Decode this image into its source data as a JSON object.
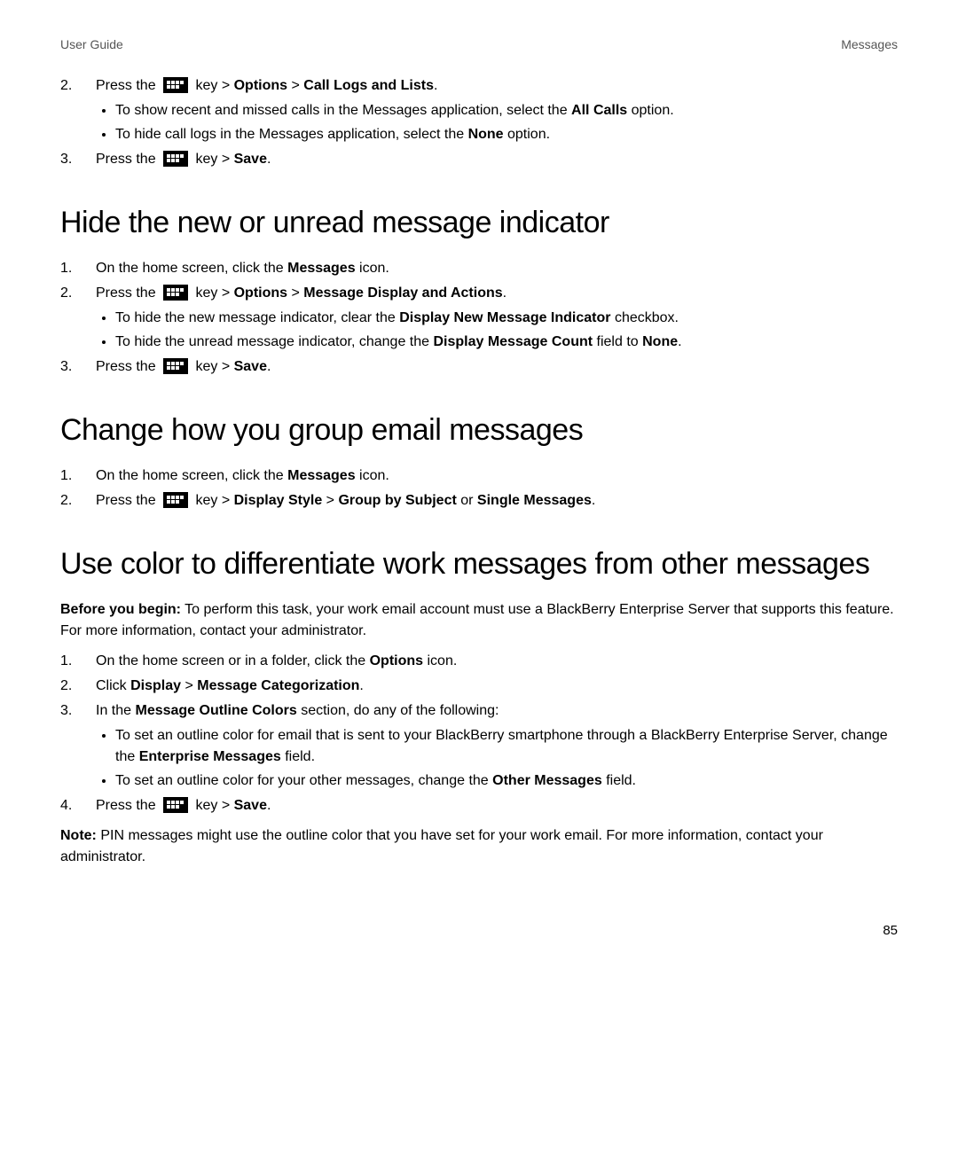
{
  "header": {
    "left": "User Guide",
    "right": "Messages"
  },
  "page_number": "85",
  "top_steps": {
    "s2": {
      "num": "2.",
      "pre": "Press the ",
      "post_key": " key > ",
      "b1": "Options",
      "sep": " > ",
      "b2": "Call Logs and Lists",
      "end": "."
    },
    "s2_bul1_a": "To show recent and missed calls in the Messages application, select the ",
    "s2_bul1_b": "All Calls",
    "s2_bul1_c": " option.",
    "s2_bul2_a": "To hide call logs in the Messages application, select the ",
    "s2_bul2_b": "None",
    "s2_bul2_c": " option.",
    "s3": {
      "num": "3.",
      "pre": "Press the ",
      "post_key": " key > ",
      "b1": "Save",
      "end": "."
    }
  },
  "sec1": {
    "title": "Hide the new or unread message indicator",
    "s1": {
      "num": "1.",
      "a": "On the home screen, click the ",
      "b": "Messages",
      "c": " icon."
    },
    "s2": {
      "num": "2.",
      "pre": "Press the ",
      "post_key": " key > ",
      "b1": "Options",
      "sep": " > ",
      "b2": "Message Display and Actions",
      "end": "."
    },
    "bul1_a": "To hide the new message indicator, clear the ",
    "bul1_b": "Display New Message Indicator",
    "bul1_c": " checkbox.",
    "bul2_a": "To hide the unread message indicator, change the ",
    "bul2_b": "Display Message Count",
    "bul2_c": " field to ",
    "bul2_d": "None",
    "bul2_e": ".",
    "s3": {
      "num": "3.",
      "pre": "Press the ",
      "post_key": " key > ",
      "b1": "Save",
      "end": "."
    }
  },
  "sec2": {
    "title": "Change how you group email messages",
    "s1": {
      "num": "1.",
      "a": "On the home screen, click the ",
      "b": "Messages",
      "c": " icon."
    },
    "s2": {
      "num": "2.",
      "pre": "Press the ",
      "post_key": " key > ",
      "b1": "Display Style",
      "sep": " > ",
      "b2": "Group by Subject",
      "mid": " or ",
      "b3": "Single Messages",
      "end": "."
    }
  },
  "sec3": {
    "title": "Use color to differentiate work messages from other messages",
    "beforeB": "Before you begin:",
    "beforeT": " To perform this task, your work email account must use a BlackBerry Enterprise Server that supports this feature. For more information, contact your administrator.",
    "s1": {
      "num": "1.",
      "a": "On the home screen or in a folder, click the ",
      "b": "Options",
      "c": " icon."
    },
    "s2": {
      "num": "2.",
      "a": "Click ",
      "b1": "Display",
      "sep": " > ",
      "b2": "Message Categorization",
      "end": "."
    },
    "s3": {
      "num": "3.",
      "a": "In the ",
      "b": "Message Outline Colors",
      "c": " section, do any of the following:"
    },
    "bul1_a": "To set an outline color for email that is sent to your BlackBerry smartphone through a BlackBerry Enterprise Server, change the ",
    "bul1_b": "Enterprise Messages",
    "bul1_c": " field.",
    "bul2_a": "To set an outline color for your other messages, change the ",
    "bul2_b": "Other Messages",
    "bul2_c": " field.",
    "s4": {
      "num": "4.",
      "pre": "Press the ",
      "post_key": " key > ",
      "b1": "Save",
      "end": "."
    },
    "noteB": "Note:",
    "noteT": " PIN messages might use the outline color that you have set for your work email. For more information, contact your administrator."
  }
}
